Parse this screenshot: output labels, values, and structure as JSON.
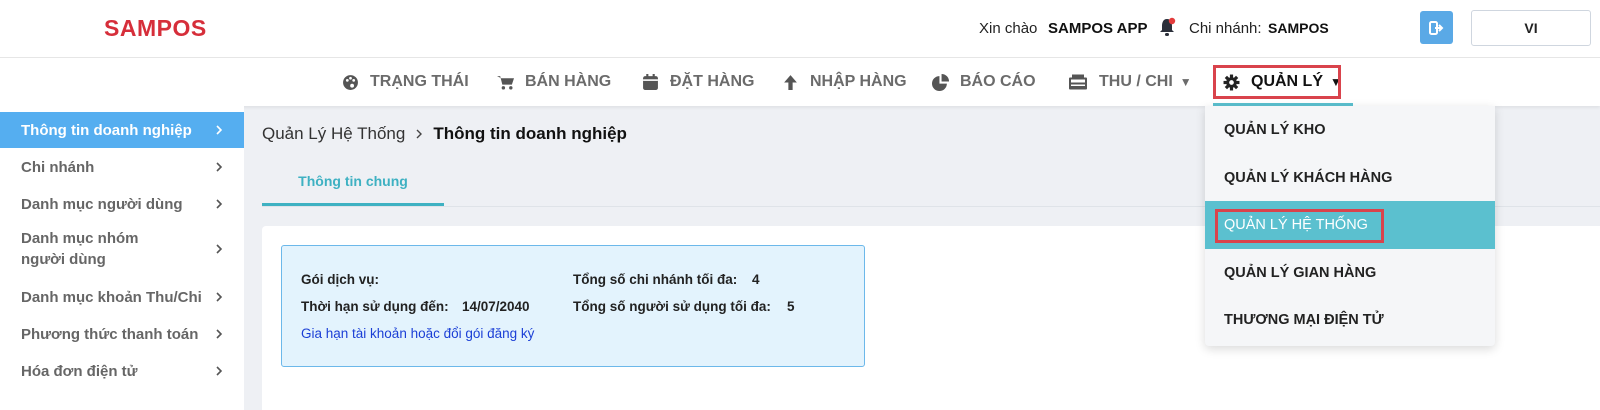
{
  "header": {
    "logo": "SAMPOS",
    "greeting": "Xin chào",
    "user_name": "SAMPOS APP",
    "branch_label": "Chi nhánh:",
    "branch_name": "SAMPOS",
    "language": "VI"
  },
  "nav": {
    "items": [
      {
        "label": "TRẠNG THÁI",
        "icon": "palette-icon"
      },
      {
        "label": "BÁN HÀNG",
        "icon": "cart-icon"
      },
      {
        "label": "ĐẶT HÀNG",
        "icon": "calendar-icon"
      },
      {
        "label": "NHẬP HÀNG",
        "icon": "arrow-up-icon"
      },
      {
        "label": "BÁO CÁO",
        "icon": "pie-chart-icon"
      },
      {
        "label": "THU / CHI",
        "icon": "cash-register-icon"
      },
      {
        "label": "QUẢN LÝ",
        "icon": "gear-icon"
      }
    ]
  },
  "sidebar": {
    "items": [
      {
        "label": "Thông tin doanh nghiệp"
      },
      {
        "label": "Chi nhánh"
      },
      {
        "label": "Danh mục người dùng"
      },
      {
        "label": "Danh mục nhóm người dùng"
      },
      {
        "label": "Danh mục khoản Thu/Chi"
      },
      {
        "label": "Phương thức thanh toán"
      },
      {
        "label": "Hóa đơn điện tử"
      }
    ]
  },
  "breadcrumb": {
    "parent": "Quản Lý Hệ Thống",
    "current": "Thông tin doanh nghiệp"
  },
  "tabs": [
    {
      "label": "Thông tin chung"
    }
  ],
  "info": {
    "package_label": "Gói dịch vụ:",
    "expiry_label": "Thời hạn sử dụng đến:",
    "expiry_value": "14/07/2040",
    "max_branches_label": "Tổng số chi nhánh tối đa:",
    "max_branches_value": "4",
    "max_users_label": "Tổng số người sử dụng tối đa:",
    "max_users_value": "5",
    "renew_link": "Gia hạn tài khoản hoặc đổi gói đăng ký"
  },
  "dropdown": {
    "items": [
      {
        "label": "QUẢN LÝ KHO"
      },
      {
        "label": "QUẢN LÝ KHÁCH HÀNG"
      },
      {
        "label": "QUẢN LÝ HỆ THỐNG"
      },
      {
        "label": "QUẢN LÝ GIAN HÀNG"
      },
      {
        "label": "THƯƠNG MẠI ĐIỆN TỬ"
      }
    ]
  },
  "colors": {
    "brand": "#d62e3a",
    "accent": "#5bc0cf",
    "sidebar_active": "#55aef0",
    "highlight_box": "#d9434c"
  }
}
